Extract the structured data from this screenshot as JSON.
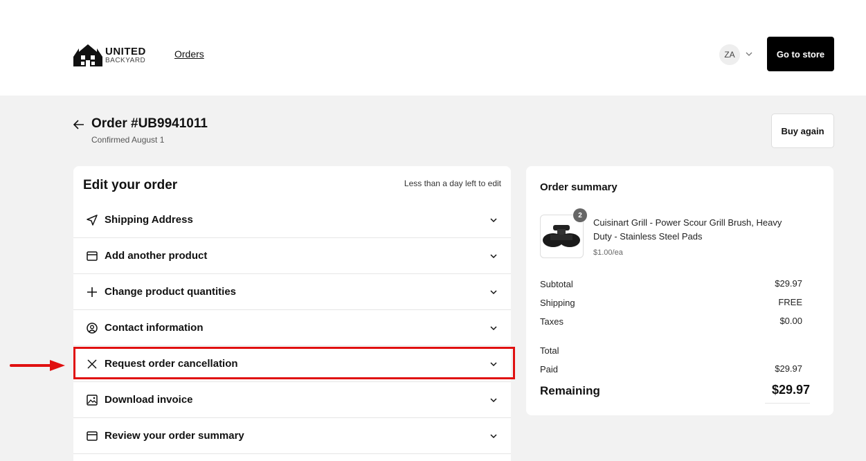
{
  "header": {
    "logo_line1": "UNITED",
    "logo_line2": "BACKYARD",
    "nav_orders": "Orders",
    "avatar_initials": "ZA",
    "go_to_store": "Go to store"
  },
  "order": {
    "title": "Order #UB9941011",
    "subtitle": "Confirmed August 1",
    "buy_again": "Buy again"
  },
  "edit": {
    "heading": "Edit your order",
    "note": "Less than a day left to edit",
    "items": [
      {
        "label": "Shipping Address",
        "icon": "navigation-arrow-icon"
      },
      {
        "label": "Add another product",
        "icon": "calendar-icon"
      },
      {
        "label": "Change product quantities",
        "icon": "plus-icon"
      },
      {
        "label": "Contact information",
        "icon": "user-circle-icon"
      },
      {
        "label": "Request order cancellation",
        "icon": "close-icon"
      },
      {
        "label": "Download invoice",
        "icon": "image-icon"
      },
      {
        "label": "Review your order summary",
        "icon": "calendar-icon"
      }
    ]
  },
  "summary": {
    "title": "Order summary",
    "product_name": "Cuisinart Grill - Power Scour Grill Brush, Heavy Duty - Stainless Steel Pads",
    "product_price": "$1.00/ea",
    "quantity": "2",
    "subtotal_label": "Subtotal",
    "subtotal_value": "$29.97",
    "shipping_label": "Shipping",
    "shipping_value": "FREE",
    "taxes_label": "Taxes",
    "taxes_value": "$0.00",
    "total_label": "Total",
    "paid_label": "Paid",
    "paid_value": "$29.97",
    "remaining_label": "Remaining",
    "remaining_value": "$29.97"
  },
  "colors": {
    "highlight": "#e01010",
    "button_dark": "#000000",
    "page_bg": "#f2f2f2"
  }
}
